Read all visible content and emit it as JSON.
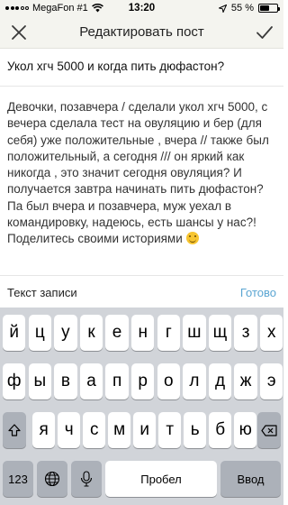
{
  "status_bar": {
    "carrier": "MegaFon #1",
    "time": "13:20",
    "battery_percent": "55 %",
    "battery_level": 0.55
  },
  "nav": {
    "title": "Редактировать пост",
    "close_icon": "close-icon",
    "confirm_icon": "checkmark-icon"
  },
  "post": {
    "title": "Укол хгч 5000 и когда пить дюфастон?",
    "body": "Девочки, позавчера / сделали укол хгч 5000, с вечера сделала тест на овуляцию и бер (для себя) уже положительные , вчера // также был положительный, а сегодня /// он яркий как никогда , это значит сегодня овуляция? И получается завтра начинать пить дюфастон? Па был вчера и позавчера, муж уехал в командировку, надеюсь, есть шансы у нас?! Поделитесь своими историями"
  },
  "accessory": {
    "label": "Текст записи",
    "done": "Готово"
  },
  "keyboard": {
    "row1": [
      "й",
      "ц",
      "у",
      "к",
      "е",
      "н",
      "г",
      "ш",
      "щ",
      "з",
      "х"
    ],
    "row2": [
      "ф",
      "ы",
      "в",
      "а",
      "п",
      "р",
      "о",
      "л",
      "д",
      "ж",
      "э"
    ],
    "row3": [
      "я",
      "ч",
      "с",
      "м",
      "и",
      "т",
      "ь",
      "б",
      "ю"
    ],
    "numbers_label": "123",
    "space_label": "Пробел",
    "return_label": "Ввод"
  },
  "colors": {
    "accent": "#5aa5d2",
    "nav_bg": "#f4f4ef",
    "keyboard_bg": "#d1d4d9",
    "emoji": "#f7c531"
  }
}
